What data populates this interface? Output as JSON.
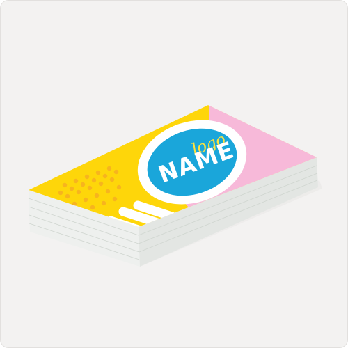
{
  "product": {
    "logo_text": "logo",
    "name_text": "NAME"
  },
  "colors": {
    "background": "#f3f2f1",
    "card_yellow": "#fed60a",
    "card_pink": "#f7b9d9",
    "circle_blue": "#1aa6da",
    "logo_yellow": "#ffe23d",
    "dots_orange": "#f4a826",
    "stack_edge": "#e8ece8"
  }
}
